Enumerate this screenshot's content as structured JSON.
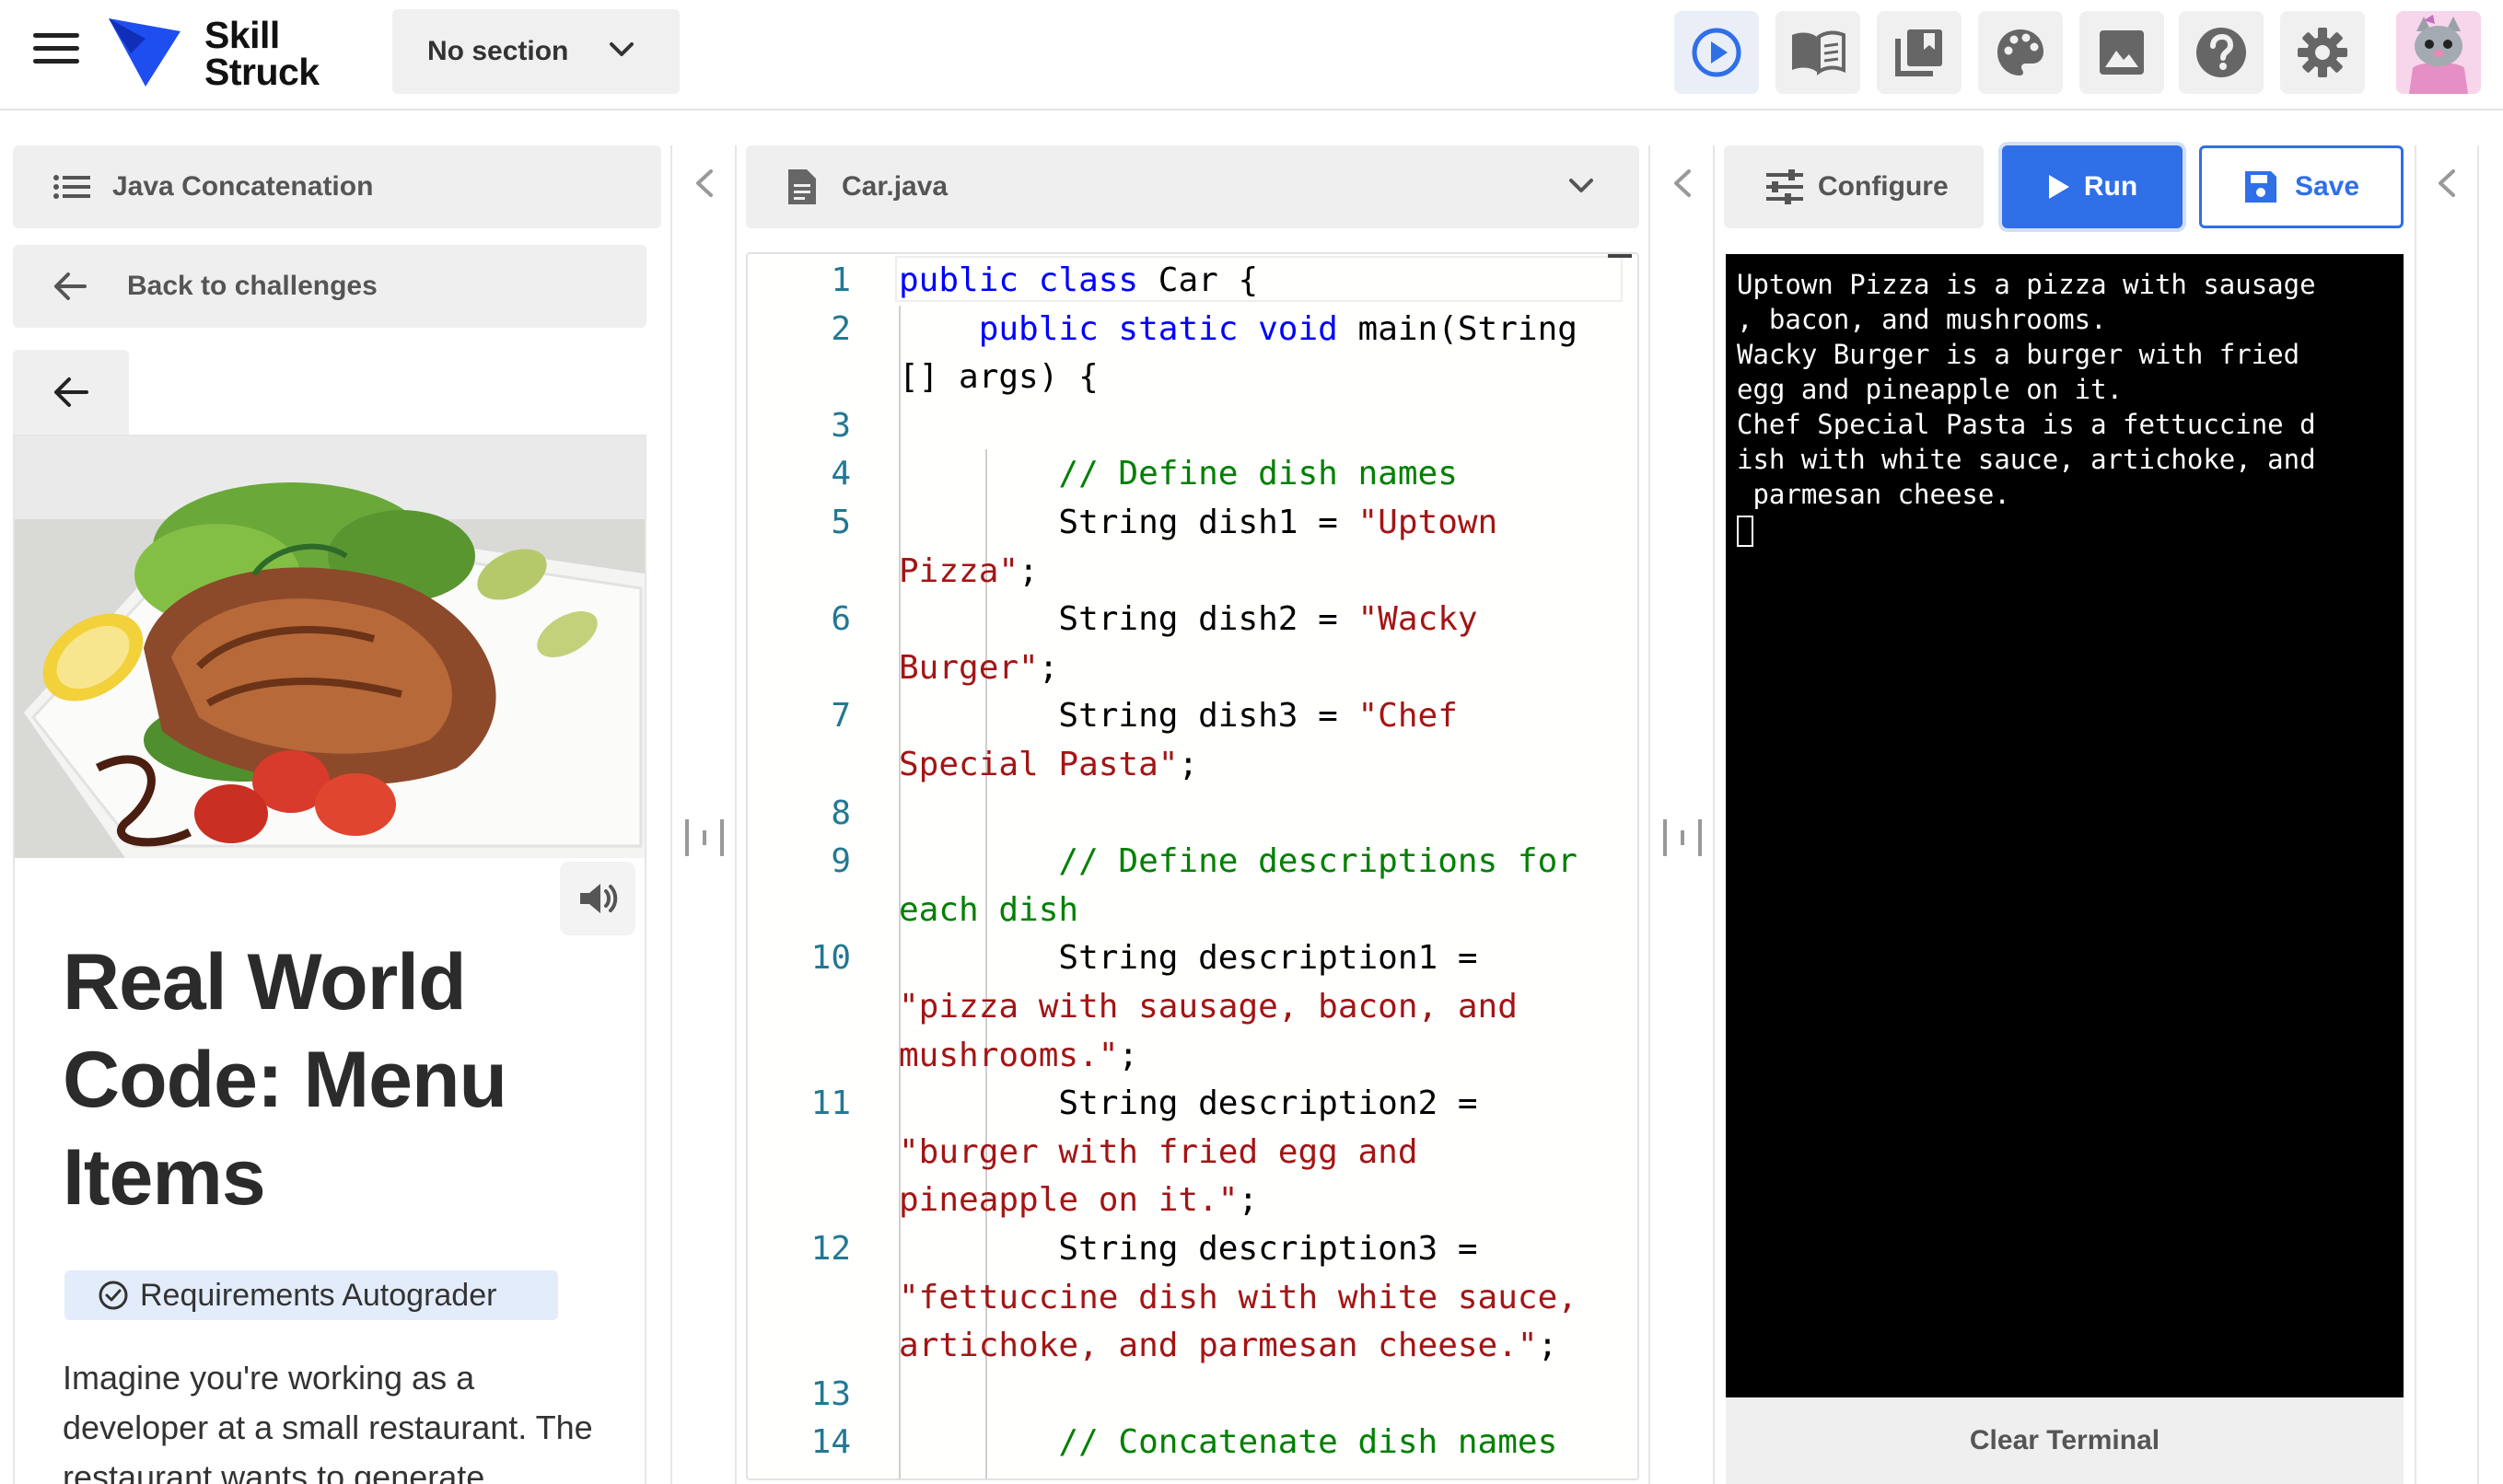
{
  "app": {
    "logo_line1": "Skill",
    "logo_line2": "Struck",
    "section_select": "No section",
    "brand_color": "#1f4ef0",
    "toolbar_icons": [
      "play-circle-icon",
      "book-icon",
      "library-icon",
      "palette-icon",
      "image-icon",
      "help-icon",
      "gear-icon"
    ]
  },
  "left": {
    "lesson_menu_label": "Java Concatenation",
    "back_label": "Back to challenges",
    "title": "Real World Code: Menu Items",
    "autograder_label": "Requirements Autograder",
    "description": "Imagine you're working as a developer at a small restaurant. The restaurant wants to generate"
  },
  "editor": {
    "file_name": "Car.java",
    "lines": [
      {
        "n": "1",
        "parts": [
          [
            "kw",
            "public class"
          ],
          [
            "pl",
            " Car {"
          ]
        ]
      },
      {
        "n": "2",
        "parts": [
          [
            "pl",
            "    "
          ],
          [
            "kw",
            "public static void"
          ],
          [
            "pl",
            " main(String"
          ]
        ]
      },
      {
        "n": "",
        "parts": [
          [
            "pl",
            "[] args) {"
          ]
        ]
      },
      {
        "n": "3",
        "parts": []
      },
      {
        "n": "4",
        "parts": [
          [
            "pl",
            "        "
          ],
          [
            "cm",
            "// Define dish names"
          ]
        ]
      },
      {
        "n": "5",
        "parts": [
          [
            "pl",
            "        String dish1 = "
          ],
          [
            "str",
            "\"Uptown"
          ]
        ]
      },
      {
        "n": "",
        "parts": [
          [
            "str",
            "Pizza\""
          ],
          [
            "pl",
            ";"
          ]
        ]
      },
      {
        "n": "6",
        "parts": [
          [
            "pl",
            "        String dish2 = "
          ],
          [
            "str",
            "\"Wacky"
          ]
        ]
      },
      {
        "n": "",
        "parts": [
          [
            "str",
            "Burger\""
          ],
          [
            "pl",
            ";"
          ]
        ]
      },
      {
        "n": "7",
        "parts": [
          [
            "pl",
            "        String dish3 = "
          ],
          [
            "str",
            "\"Chef"
          ]
        ]
      },
      {
        "n": "",
        "parts": [
          [
            "str",
            "Special Pasta\""
          ],
          [
            "pl",
            ";"
          ]
        ]
      },
      {
        "n": "8",
        "parts": []
      },
      {
        "n": "9",
        "parts": [
          [
            "pl",
            "        "
          ],
          [
            "cm",
            "// Define descriptions for"
          ]
        ]
      },
      {
        "n": "",
        "parts": [
          [
            "cm",
            "each dish"
          ]
        ]
      },
      {
        "n": "10",
        "parts": [
          [
            "pl",
            "        String description1 ="
          ]
        ]
      },
      {
        "n": "",
        "parts": [
          [
            "str",
            "\"pizza with sausage, bacon, and"
          ]
        ]
      },
      {
        "n": "",
        "parts": [
          [
            "str",
            "mushrooms.\""
          ],
          [
            "pl",
            ";"
          ]
        ]
      },
      {
        "n": "11",
        "parts": [
          [
            "pl",
            "        String description2 ="
          ]
        ]
      },
      {
        "n": "",
        "parts": [
          [
            "str",
            "\"burger with fried egg and"
          ]
        ]
      },
      {
        "n": "",
        "parts": [
          [
            "str",
            "pineapple on it.\""
          ],
          [
            "pl",
            ";"
          ]
        ]
      },
      {
        "n": "12",
        "parts": [
          [
            "pl",
            "        String description3 ="
          ]
        ]
      },
      {
        "n": "",
        "parts": [
          [
            "str",
            "\"fettuccine dish with white sauce,"
          ]
        ]
      },
      {
        "n": "",
        "parts": [
          [
            "str",
            "artichoke, and parmesan cheese.\""
          ],
          [
            "pl",
            ";"
          ]
        ]
      },
      {
        "n": "13",
        "parts": []
      },
      {
        "n": "14",
        "parts": [
          [
            "pl",
            "        "
          ],
          [
            "cm",
            "// Concatenate dish names"
          ]
        ]
      }
    ]
  },
  "right": {
    "configure_label": "Configure",
    "run_label": "Run",
    "save_label": "Save",
    "clear_label": "Clear Terminal",
    "terminal_lines": [
      "Uptown Pizza is a pizza with sausage",
      ", bacon, and mushrooms.",
      "Wacky Burger is a burger with fried",
      "egg and pineapple on it.",
      "Chef Special Pasta is a fettuccine d",
      "ish with white sauce, artichoke, and",
      " parmesan cheese."
    ]
  }
}
